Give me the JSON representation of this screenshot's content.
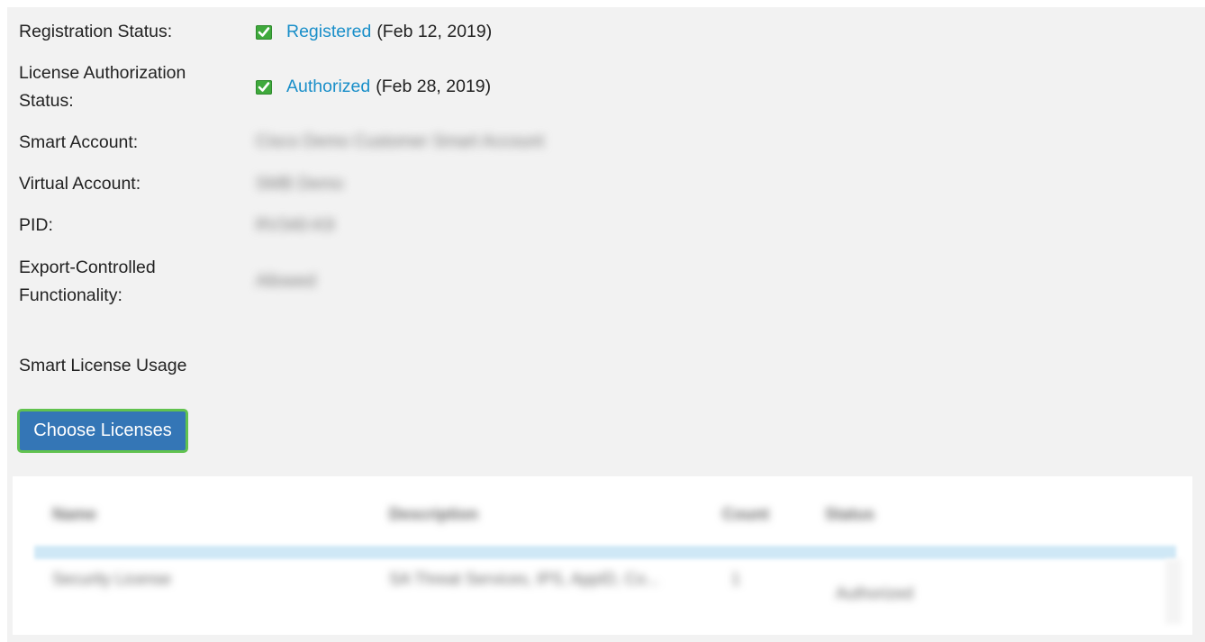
{
  "details": {
    "registration": {
      "label": "Registration Status:",
      "status": "Registered",
      "date": "(Feb 12, 2019)"
    },
    "authorization": {
      "label_line1": "License Authorization",
      "label_line2": "Status:",
      "status": "Authorized",
      "date": "(Feb 28, 2019)"
    },
    "smart_account": {
      "label": "Smart Account:",
      "value": "Cisco Demo Customer Smart Account"
    },
    "virtual_account": {
      "label": "Virtual Account:",
      "value": "SMB Demo"
    },
    "pid": {
      "label": "PID:",
      "value": "RV340-K9"
    },
    "export_controlled": {
      "label_line1": "Export-Controlled",
      "label_line2": "Functionality:",
      "value": "Allowed"
    }
  },
  "usage": {
    "heading": "Smart License Usage",
    "choose_button": "Choose Licenses"
  },
  "table": {
    "columns": [
      "Name",
      "Description",
      "Count",
      "Status"
    ],
    "rows": [
      {
        "name": "Security License",
        "description": "SA Threat Services, IPS, AppID, Co...",
        "count": "1",
        "status": "Authorized"
      }
    ]
  },
  "colors": {
    "panel_bg": "#f2f2f2",
    "link": "#1a8fc9",
    "check_green": "#3fa93c",
    "button_bg": "#3476b6",
    "button_outline": "#61c24f"
  }
}
